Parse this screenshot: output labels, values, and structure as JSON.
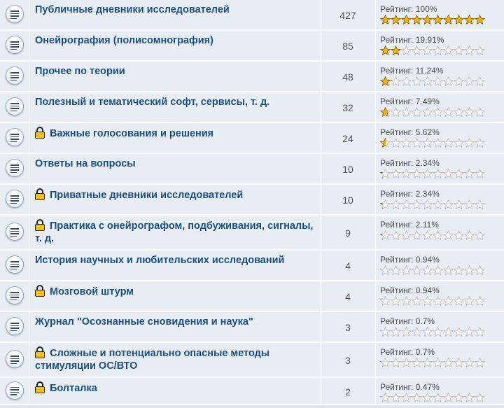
{
  "rating_prefix": "Рейтинг: ",
  "colors": {
    "title": "#1d4f7d",
    "row_bg": "#e7edf3",
    "star_fill": "#f0b418",
    "star_empty_stroke": "#b9b9b9",
    "lock": "#f2c200"
  },
  "icons": {
    "topic": "topic-document-icon",
    "lock": "lock-icon",
    "star": "star-icon"
  },
  "forums": [
    {
      "title": "Публичные дневники исследователей",
      "locked": false,
      "count": "427",
      "rating_percent": "100%",
      "stars": 1.0
    },
    {
      "title": "Онейрография (полисомнография)",
      "locked": false,
      "count": "85",
      "rating_percent": "19.91%",
      "stars": 0.1991
    },
    {
      "title": "Прочее по теории",
      "locked": false,
      "count": "48",
      "rating_percent": "11.24%",
      "stars": 0.1124
    },
    {
      "title": "Полезный и тематический софт, сервисы, т. д.",
      "locked": false,
      "count": "32",
      "rating_percent": "7.49%",
      "stars": 0.0749
    },
    {
      "title": "Важные голосования и решения",
      "locked": true,
      "count": "24",
      "rating_percent": "5.62%",
      "stars": 0.0562
    },
    {
      "title": "Ответы на вопросы",
      "locked": false,
      "count": "10",
      "rating_percent": "2.34%",
      "stars": 0.0234
    },
    {
      "title": "Приватные дневники исследователей",
      "locked": true,
      "count": "10",
      "rating_percent": "2.34%",
      "stars": 0.0234
    },
    {
      "title": "Практика с онейрографом, подбуживания, сигналы, т. д.",
      "locked": true,
      "count": "9",
      "rating_percent": "2.11%",
      "stars": 0.0211
    },
    {
      "title": "История научных и любительских исследований",
      "locked": false,
      "count": "4",
      "rating_percent": "0.94%",
      "stars": 0.0094
    },
    {
      "title": "Мозговой штурм",
      "locked": true,
      "count": "4",
      "rating_percent": "0.94%",
      "stars": 0.0094
    },
    {
      "title": "Журнал \"Осознанные сновидения и наука\"",
      "locked": false,
      "count": "3",
      "rating_percent": "0.7%",
      "stars": 0.007
    },
    {
      "title": "Сложные и потенциально опасные методы стимуляции ОС/ВТО",
      "locked": true,
      "count": "3",
      "rating_percent": "0.7%",
      "stars": 0.007
    },
    {
      "title": "Болталка",
      "locked": true,
      "count": "2",
      "rating_percent": "0.47%",
      "stars": 0.0047
    }
  ]
}
